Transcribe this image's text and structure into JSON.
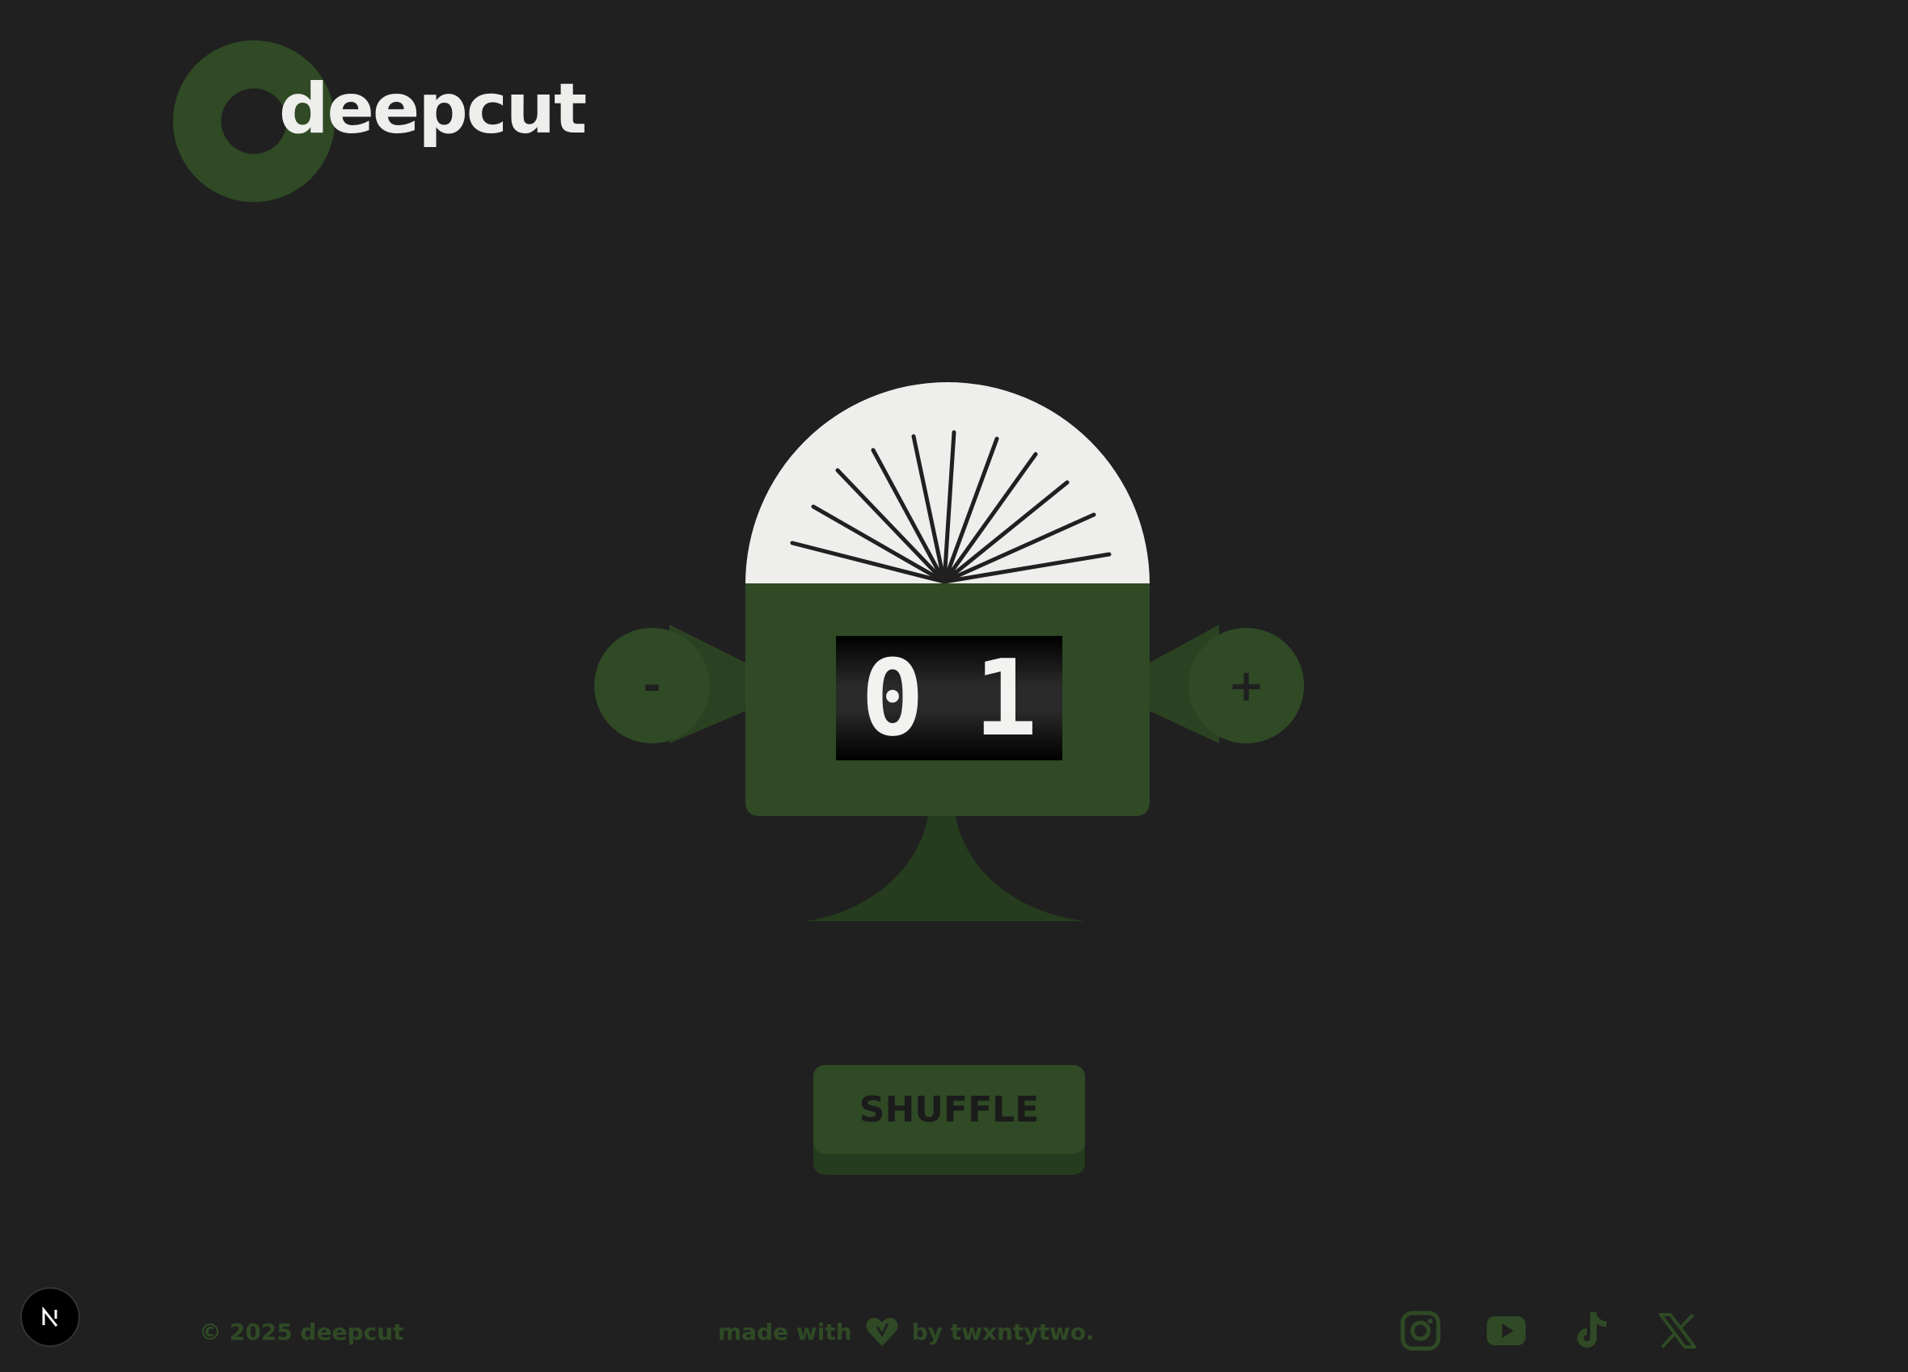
{
  "brand": {
    "name": "deepcut",
    "accent": "#2f4a25",
    "background": "#202020",
    "light": "#eeeeec"
  },
  "machine": {
    "counter_digits": [
      "0",
      "1"
    ],
    "decrement_label": "-",
    "increment_label": "+"
  },
  "actions": {
    "shuffle_label": "SHUFFLE"
  },
  "footer": {
    "copyright": "© 2025 deepcut",
    "made_with": "made with",
    "made_by": "by twxntytwo.",
    "heart_icon": "heart-icon",
    "socials": [
      {
        "name": "Instagram",
        "icon": "instagram-icon"
      },
      {
        "name": "YouTube",
        "icon": "youtube-icon"
      },
      {
        "name": "TikTok",
        "icon": "tiktok-icon"
      },
      {
        "name": "X",
        "icon": "x-icon"
      }
    ]
  },
  "dev_badge": {
    "letter": "N",
    "icon": "nextjs-icon"
  }
}
